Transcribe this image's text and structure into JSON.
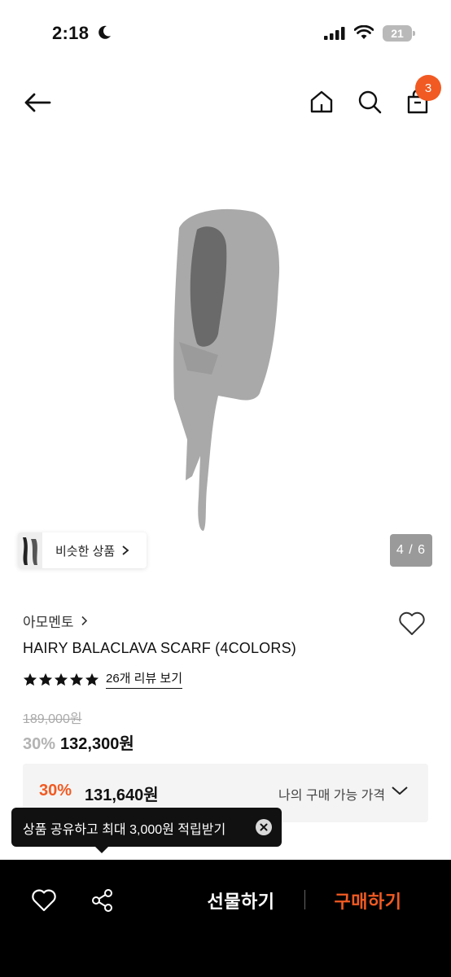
{
  "status_bar": {
    "time": "2:18",
    "battery": "21"
  },
  "nav": {
    "cart_count": "3"
  },
  "gallery": {
    "similar_label": "비슷한 상품",
    "counter": "4 / 6"
  },
  "product": {
    "brand": "아모멘토",
    "title": "HAIRY BALACLAVA SCARF (4COLORS)",
    "rating": 5,
    "review_link": "26개 리뷰 보기",
    "original_price": "189,000원",
    "discount": "30%",
    "price": "132,300원"
  },
  "my_price": {
    "discount": "30%",
    "price": "131,640원",
    "label": "나의 구매 가능 가격"
  },
  "tooltip": {
    "text": "상품 공유하고 최대 3,000원 적립받기"
  },
  "bottom_bar": {
    "gift_label": "선물하기",
    "buy_label": "구매하기"
  },
  "colors": {
    "accent": "#f15a22",
    "bar_bg": "#000000"
  },
  "icons": [
    "moon-icon",
    "cellular-signal-icon",
    "wifi-icon",
    "battery-icon",
    "back-arrow-icon",
    "home-icon",
    "search-icon",
    "shopping-bag-icon",
    "chevron-right-icon",
    "heart-icon",
    "star-icon",
    "chevron-down-icon",
    "close-icon",
    "share-icon"
  ]
}
